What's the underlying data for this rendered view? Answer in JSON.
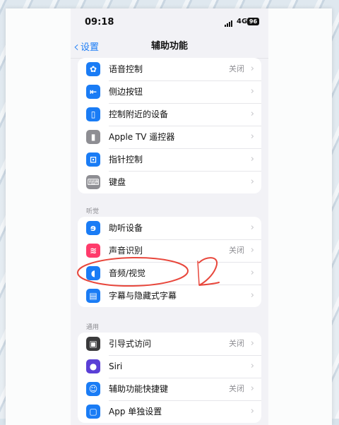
{
  "status": {
    "time": "09:18",
    "network": "4G",
    "battery": "96"
  },
  "nav": {
    "back_label": "设置",
    "title": "辅助功能"
  },
  "groups": [
    {
      "header": "",
      "items": [
        {
          "label": "语音控制",
          "value": "关闭",
          "icon": "speech-bubble-icon",
          "color": "#1a7cf5"
        },
        {
          "label": "侧边按钮",
          "value": "",
          "icon": "side-button-icon",
          "color": "#1a7cf5"
        },
        {
          "label": "控制附近的设备",
          "value": "",
          "icon": "nearby-device-icon",
          "color": "#1a7cf5"
        },
        {
          "label": "Apple TV 遥控器",
          "value": "",
          "icon": "remote-icon",
          "color": "#8e8e93"
        },
        {
          "label": "指针控制",
          "value": "",
          "icon": "pointer-icon",
          "color": "#1a7cf5"
        },
        {
          "label": "键盘",
          "value": "",
          "icon": "keyboard-icon",
          "color": "#8e8e93"
        }
      ]
    },
    {
      "header": "听觉",
      "items": [
        {
          "label": "助听设备",
          "value": "",
          "icon": "ear-icon",
          "color": "#1a7cf5"
        },
        {
          "label": "声音识别",
          "value": "关闭",
          "icon": "sound-wave-icon",
          "color": "#ff3b6b"
        },
        {
          "label": "音频/视觉",
          "value": "",
          "icon": "speaker-eye-icon",
          "color": "#1a7cf5"
        },
        {
          "label": "字幕与隐藏式字幕",
          "value": "",
          "icon": "caption-icon",
          "color": "#1a7cf5"
        }
      ]
    },
    {
      "header": "通用",
      "items": [
        {
          "label": "引导式访问",
          "value": "关闭",
          "icon": "lock-icon",
          "color": "#3a3a3c"
        },
        {
          "label": "Siri",
          "value": "",
          "icon": "siri-icon",
          "color": "#5a3fd6"
        },
        {
          "label": "辅助功能快捷键",
          "value": "关闭",
          "icon": "accessibility-icon",
          "color": "#1a7cf5"
        },
        {
          "label": "App 单独设置",
          "value": "",
          "icon": "app-settings-icon",
          "color": "#1a7cf5"
        }
      ]
    }
  ],
  "annotation": {
    "text": "2",
    "color": "#e8473c"
  }
}
